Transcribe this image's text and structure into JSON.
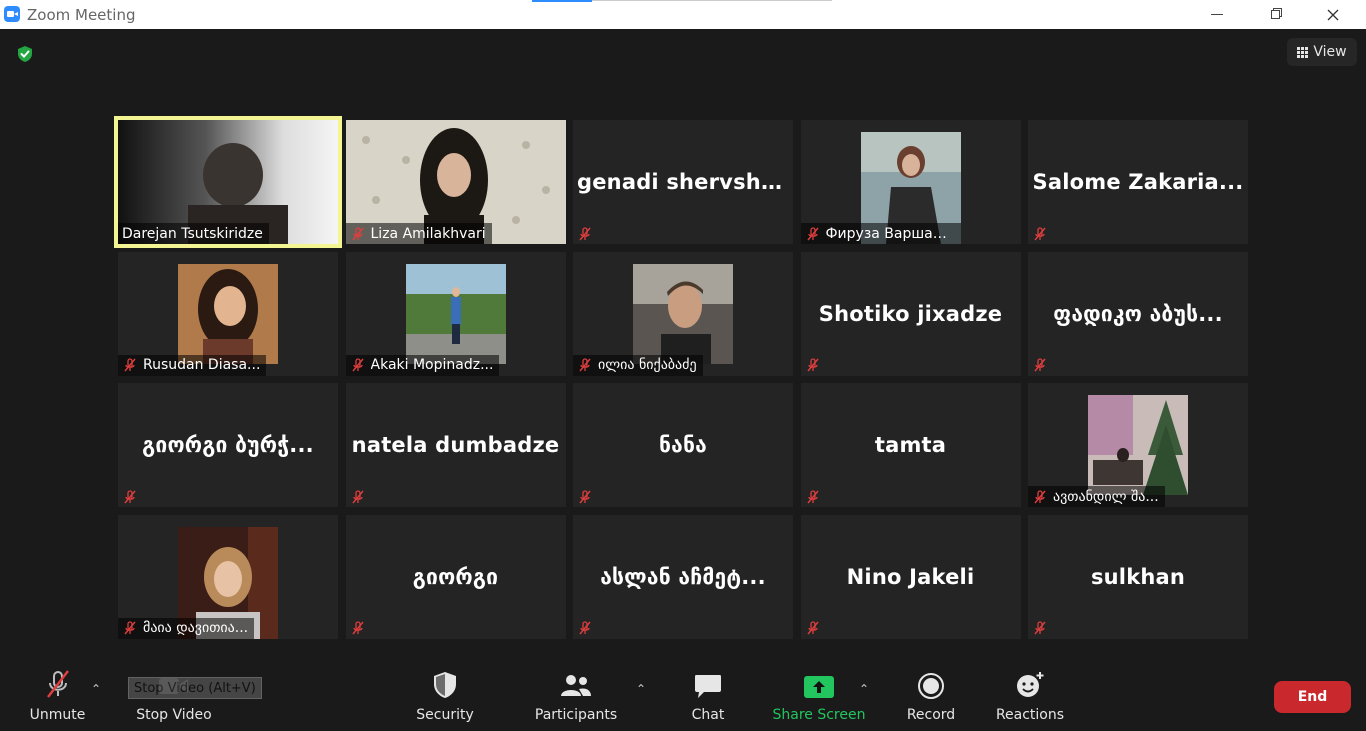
{
  "window": {
    "title": "Zoom Meeting",
    "controls": {
      "minimize": "minimize",
      "maximize": "maximize",
      "close": "close"
    }
  },
  "overlay": {
    "encryption_icon": "shield-check-icon",
    "view_label": "View"
  },
  "participants": [
    {
      "name": "Darejan Tsutskiridze",
      "video": true,
      "muted": false,
      "active": true
    },
    {
      "name": "Liza Amilakhvari",
      "video": true,
      "muted": true
    },
    {
      "name": "genadi  shervshi...",
      "video": false,
      "muted": true
    },
    {
      "name": "Фируза Варшан...",
      "video": true,
      "muted": true
    },
    {
      "name": "Salome  Zakaria...",
      "video": false,
      "muted": true
    },
    {
      "name": "Rusudan Diasa...",
      "video": true,
      "muted": true
    },
    {
      "name": "Akaki Mopinadz...",
      "video": true,
      "muted": true
    },
    {
      "name": "ილია ნიქაბაძე",
      "video": true,
      "muted": true
    },
    {
      "name": "Shotiko jixadze",
      "video": false,
      "muted": true
    },
    {
      "name": "ფადიკო აბუს...",
      "video": false,
      "muted": true
    },
    {
      "name": "გიორგი ბურჭ...",
      "video": false,
      "muted": true
    },
    {
      "name": "natela dumbadze",
      "video": false,
      "muted": true
    },
    {
      "name": "ნანა",
      "video": false,
      "muted": true
    },
    {
      "name": "tamta",
      "video": false,
      "muted": true
    },
    {
      "name": "ავთანდილ შა...",
      "video": true,
      "muted": true
    },
    {
      "name": "მაია დავითია...",
      "video": true,
      "muted": true
    },
    {
      "name": "გიორგი",
      "video": false,
      "muted": true
    },
    {
      "name": "ასლან  აჩმეტ...",
      "video": false,
      "muted": true
    },
    {
      "name": "Nino Jakeli",
      "video": false,
      "muted": true
    },
    {
      "name": "sulkhan",
      "video": false,
      "muted": true
    }
  ],
  "toolbar": {
    "unmute": "Unmute",
    "stop_video": "Stop Video",
    "tooltip": "Stop Video (Alt+V)",
    "security": "Security",
    "participants": "Participants",
    "chat": "Chat",
    "share_screen": "Share Screen",
    "record": "Record",
    "reactions": "Reactions",
    "end": "End"
  },
  "colors": {
    "background": "#1a1a1a",
    "tile": "#242424",
    "active_speaker": "#f2f591",
    "muted_red": "#e03e3e",
    "share_green": "#22c55e",
    "end_red": "#c9282d"
  }
}
